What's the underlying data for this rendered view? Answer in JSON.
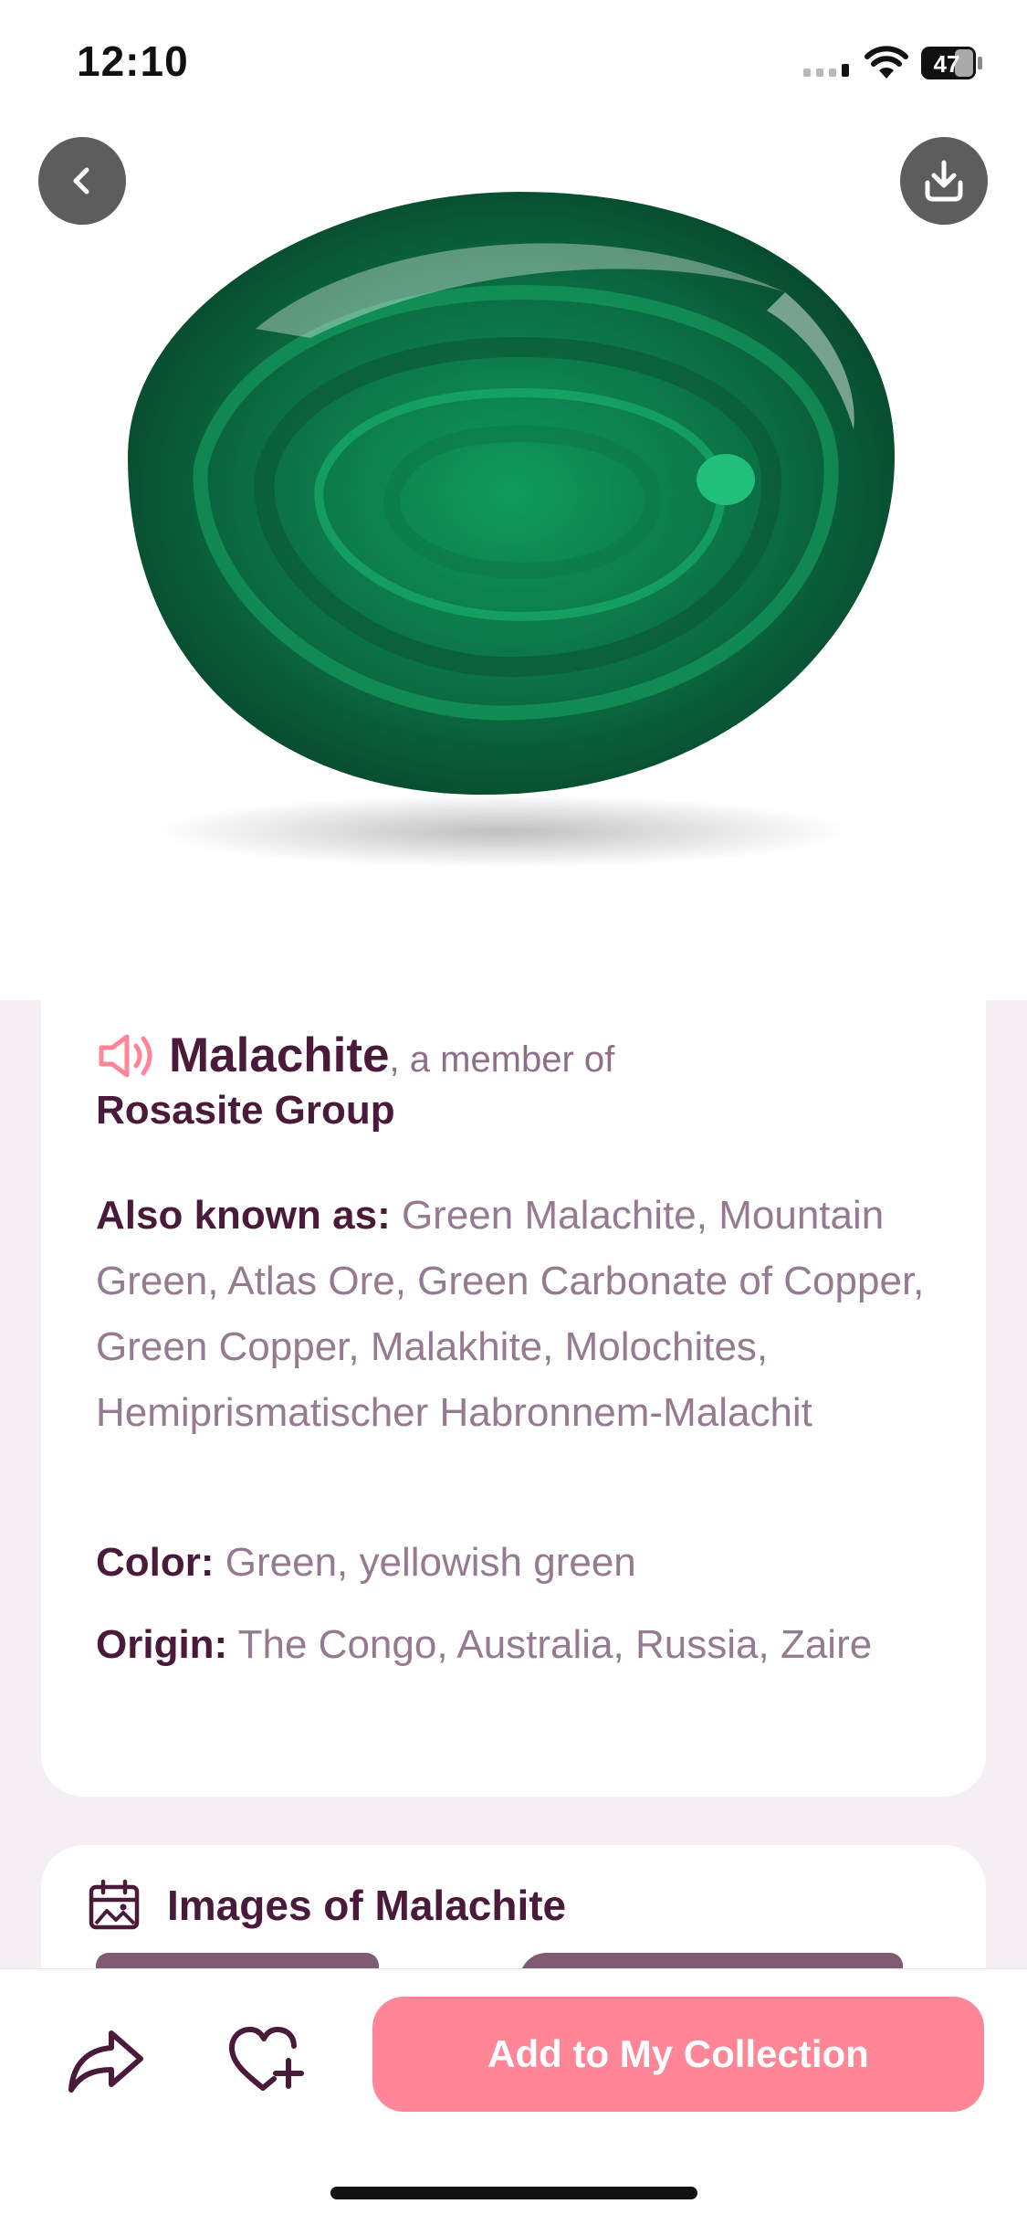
{
  "status_bar": {
    "time": "12:10",
    "battery": "47"
  },
  "hero": {
    "image": "malachite-stone"
  },
  "nav": {
    "back_icon": "chevron-left-icon",
    "download_icon": "download-icon"
  },
  "stone": {
    "name": "Malachite",
    "member_of": ", a member of",
    "group": "Rosasite Group",
    "also_known_as_label": "Also known as:",
    "also_known_as": "Green Malachite, Mountain Green, Atlas Ore, Green Carbonate of Copper, Green Copper, Malakhite, Molochites, Hemiprismatischer Habronnem-Malachit",
    "color_label": "Color:",
    "color": "Green, yellowish green",
    "origin_label": "Origin:",
    "origin": "The Congo, Australia, Russia, Zaire"
  },
  "images_section": {
    "title": "Images of Malachite"
  },
  "actions": {
    "add_label": "Add to My Collection"
  },
  "colors": {
    "accent": "#ff8597",
    "title": "#4a1a3a",
    "muted": "#957a91",
    "background": "#f5eff4"
  }
}
